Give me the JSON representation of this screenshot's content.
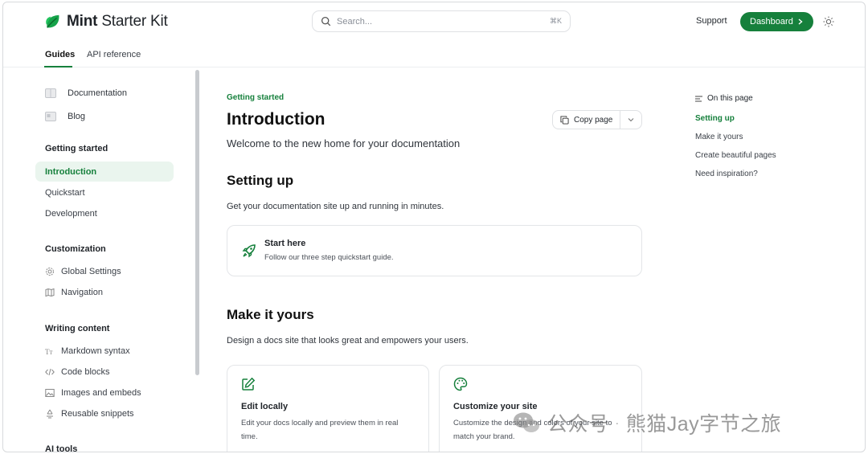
{
  "header": {
    "brand_bold": "Mint",
    "brand_rest": " Starter Kit",
    "search_placeholder": "Search...",
    "search_shortcut": "⌘K",
    "support_label": "Support",
    "dashboard_label": "Dashboard",
    "accent_color": "#16803c"
  },
  "tabs": [
    {
      "label": "Guides",
      "active": true
    },
    {
      "label": "API reference",
      "active": false
    }
  ],
  "sidebar": {
    "top_links": [
      {
        "label": "Documentation",
        "icon": "book-icon"
      },
      {
        "label": "Blog",
        "icon": "newspaper-icon"
      }
    ],
    "groups": [
      {
        "title": "Getting started",
        "items": [
          "Introduction",
          "Quickstart",
          "Development"
        ],
        "active": "Introduction"
      },
      {
        "title": "Customization",
        "items": [
          "Global Settings",
          "Navigation"
        ],
        "icons": [
          "gear-icon",
          "map-icon"
        ]
      },
      {
        "title": "Writing content",
        "items": [
          "Markdown syntax",
          "Code blocks",
          "Images and embeds",
          "Reusable snippets"
        ],
        "icons": [
          "text-size-icon",
          "code-icon",
          "image-icon",
          "recycle-icon"
        ]
      },
      {
        "title": "AI tools"
      }
    ]
  },
  "main": {
    "eyebrow": "Getting started",
    "title": "Introduction",
    "copy_page_label": "Copy page",
    "lead": "Welcome to the new home for your documentation",
    "section1_title": "Setting up",
    "section1_text": "Get your documentation site up and running in minutes.",
    "start_card": {
      "title": "Start here",
      "desc": "Follow our three step quickstart guide."
    },
    "section2_title": "Make it yours",
    "section2_text": "Design a docs site that looks great and empowers your users.",
    "cards": [
      {
        "title": "Edit locally",
        "desc": "Edit your docs locally and preview them in real time."
      },
      {
        "title": "Customize your site",
        "desc": "Customize the design and colors of your site to match your brand."
      }
    ]
  },
  "toc": {
    "heading": "On this page",
    "items": [
      "Setting up",
      "Make it yours",
      "Create beautiful pages",
      "Need inspiration?"
    ],
    "active": "Setting up"
  },
  "watermark": {
    "source": "公众号",
    "dot": "·",
    "name": "熊猫Jay字节之旅"
  }
}
